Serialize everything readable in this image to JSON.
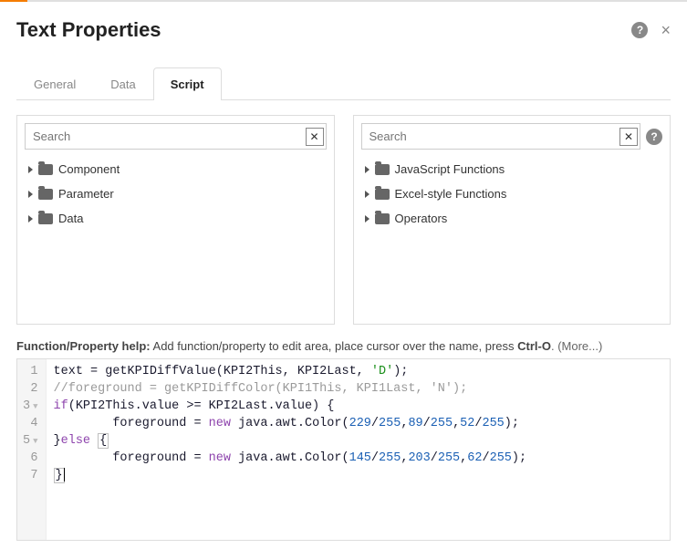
{
  "header": {
    "title": "Text Properties"
  },
  "tabs": {
    "general": "General",
    "data": "Data",
    "script": "Script"
  },
  "left_panel": {
    "search_placeholder": "Search",
    "items": [
      "Component",
      "Parameter",
      "Data"
    ]
  },
  "right_panel": {
    "search_placeholder": "Search",
    "items": [
      "JavaScript Functions",
      "Excel-style Functions",
      "Operators"
    ]
  },
  "help": {
    "label": "Function/Property help:",
    "text": " Add function/property to edit area, place cursor over the name, press ",
    "shortcut": "Ctrl-O",
    "more": ". (More...)"
  },
  "code": {
    "l1": "text = getKPIDiffValue(KPI2This, KPI2Last, 'D');",
    "l2": "//foreground = getKPIDiffColor(KPI1This, KPI1Last, 'N');",
    "l3_a": "if",
    "l3_b": "(KPI2This.value >= KPI2Last.value) {",
    "l4_a": "        foreground = ",
    "l4_new": "new",
    "l4_b": " java.awt.Color(",
    "l4_n1": "229",
    "l4_s": "/",
    "l4_n2": "255",
    "l4_c": ",",
    "l4_n3": "89",
    "l4_n4": "255",
    "l4_n5": "52",
    "l4_n6": "255",
    "l4_end": ");",
    "l5_a": "}",
    "l5_else": "else",
    "l5_b": " ",
    "l5_brace": "{",
    "l6_a": "        foreground = ",
    "l6_new": "new",
    "l6_b": " java.awt.Color(",
    "l6_n1": "145",
    "l6_n2": "255",
    "l6_n3": "203",
    "l6_n4": "255",
    "l6_n5": "62",
    "l6_n6": "255",
    "l6_end": ");",
    "l7": "}"
  },
  "gutter": [
    "1",
    "2",
    "3",
    "4",
    "5",
    "6",
    "7"
  ]
}
